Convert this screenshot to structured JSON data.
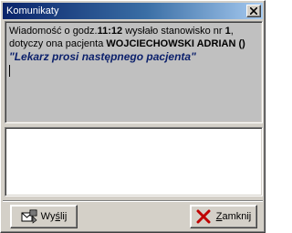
{
  "window": {
    "title": "Komunikaty"
  },
  "message": {
    "line1_prefix": "Wiadomość o godz.",
    "time": "11:12",
    "line1_middle": " wysłało stanowisko nr ",
    "station": "1",
    "line1_suffix": ",",
    "line2_prefix": "dotyczy ona pacjenta ",
    "patient": "WOJCIECHOWSKI ADRIAN ()",
    "quote": "\"Lekarz prosi następnego pacjenta\""
  },
  "reply": {
    "value": ""
  },
  "buttons": {
    "send_pre": "Wy",
    "send_underlined": "ś",
    "send_post": "lij",
    "close_underlined": "Z",
    "close_post": "amknij"
  },
  "icons": {
    "close": "close-icon",
    "send": "send-message-icon",
    "cancel": "red-x-icon"
  }
}
